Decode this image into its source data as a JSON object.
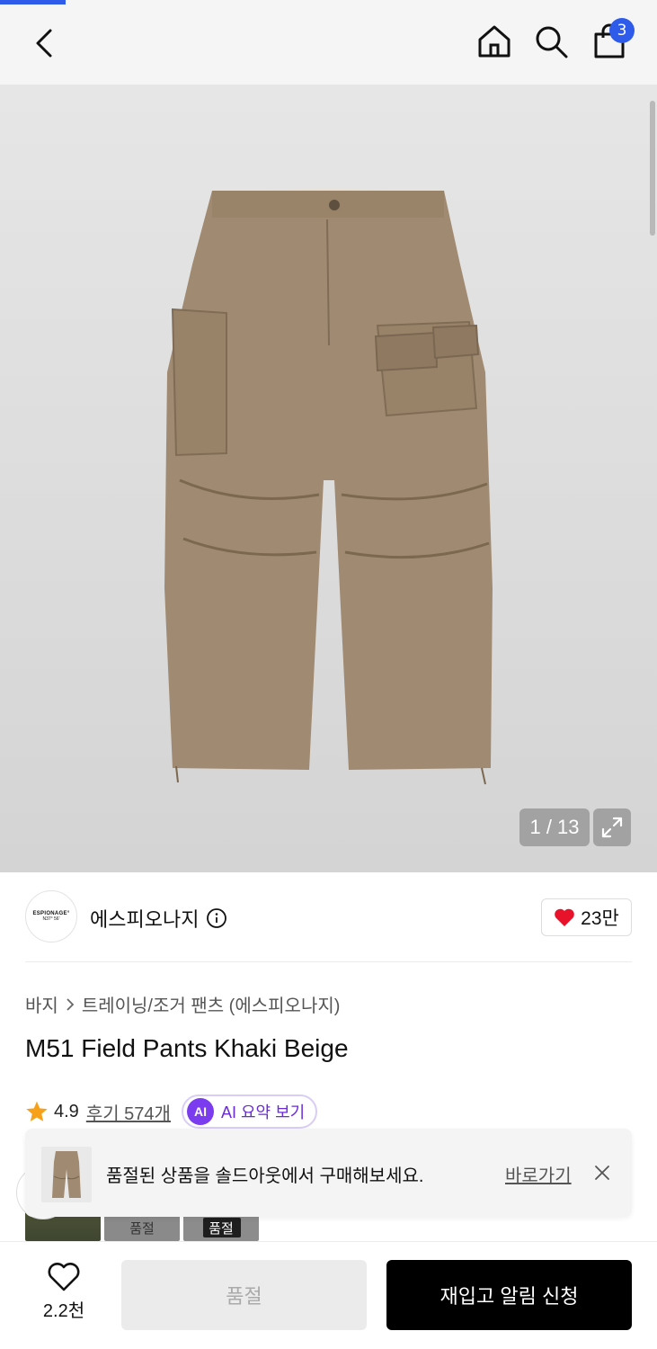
{
  "header": {
    "cart_count": "3"
  },
  "gallery": {
    "counter": "1 / 13"
  },
  "brand": {
    "logo_line1": "ESPIONAGE°",
    "logo_line2": "N37° 56'",
    "name": "에스피오나지",
    "likes": "23만"
  },
  "breadcrumb": {
    "category": "바지",
    "subcategory": "트레이닝/조거 팬츠 (에스피오나지)"
  },
  "product": {
    "title": "M51 Field Pants Khaki Beige",
    "rating": "4.9",
    "reviews": "후기 574개",
    "ai_badge": "AI",
    "ai_summary": "AI 요약 보기"
  },
  "swatches": [
    {
      "label": ""
    },
    {
      "label": "품절"
    },
    {
      "label": "품절"
    }
  ],
  "toast": {
    "message": "품절된 상품을 솔드아웃에서 구매해보세요.",
    "link": "바로가기"
  },
  "bottom": {
    "wish_count": "2.2천",
    "soldout_label": "품절",
    "restock_label": "재입고 알림 신청"
  },
  "colors": {
    "accent": "#2f5bea",
    "ai_purple": "#7b3cf0",
    "heart": "#e8132a",
    "star": "#f7a11a",
    "pants": "#a08b72"
  }
}
